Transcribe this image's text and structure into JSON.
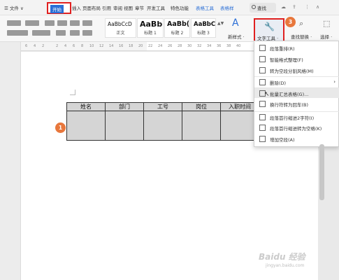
{
  "tabs": [
    {
      "id": "menu",
      "label": "☰ 文件 ∨"
    },
    {
      "id": "start",
      "label": "开始"
    },
    {
      "id": "insert",
      "label": "插入"
    },
    {
      "id": "layout",
      "label": "页面布局"
    },
    {
      "id": "ref",
      "label": "引用"
    },
    {
      "id": "review",
      "label": "审阅"
    },
    {
      "id": "view",
      "label": "视图"
    },
    {
      "id": "section",
      "label": "章节"
    },
    {
      "id": "dev",
      "label": "开发工具"
    },
    {
      "id": "special",
      "label": "特色功能"
    },
    {
      "id": "tabletool",
      "label": "表格工具"
    },
    {
      "id": "tablestyle",
      "label": "表格样"
    }
  ],
  "search": {
    "label": "查找"
  },
  "styles": [
    {
      "sample": "AaBbCcD",
      "label": "正文"
    },
    {
      "sample": "AaBb",
      "label": "标题 1"
    },
    {
      "sample": "AaBb(",
      "label": "标题 2"
    },
    {
      "sample": "AaBbC",
      "label": "标题 3"
    }
  ],
  "ribbon_buttons": {
    "new_style": "新样式 ·",
    "text_tools": "文字工具 ·",
    "find_replace": "查找替换 ·",
    "select": "选择 ·"
  },
  "badges": {
    "b1": "1",
    "b2": "2",
    "b3": "3"
  },
  "ruler": {
    "ticks": [
      "6",
      "4",
      "2",
      "2",
      "4",
      "6",
      "8",
      "10",
      "12",
      "14",
      "16",
      "18",
      "20",
      "22",
      "24",
      "26",
      "28",
      "30",
      "32",
      "34",
      "36",
      "38",
      "40"
    ]
  },
  "table": {
    "headers": [
      "姓名",
      "部门",
      "工号",
      "岗位",
      "入职时间"
    ],
    "rows": [
      [
        "",
        "",
        "",
        "",
        ""
      ]
    ]
  },
  "menu": {
    "items": [
      {
        "label": "段落重排(R)"
      },
      {
        "label": "智能格式整理(F)"
      },
      {
        "label": "转为空段分割风格(M)"
      },
      {
        "label": "删除(D)",
        "arrow": "›"
      },
      {
        "label": "批量汇总表格(G)..."
      },
      {
        "label": "换行符转为回车(B)"
      },
      {
        "label": "段落首行缩进2字符(I)"
      },
      {
        "label": "段落首行缩进转为空格(K)"
      },
      {
        "label": "增加空段(A)"
      }
    ]
  },
  "watermark": {
    "text": "Baidu 经验",
    "sub": "jingyan.baidu.com"
  },
  "colors": {
    "accent": "#2b6fd6",
    "highlight": "#e02020",
    "badge": "#e8773c"
  }
}
